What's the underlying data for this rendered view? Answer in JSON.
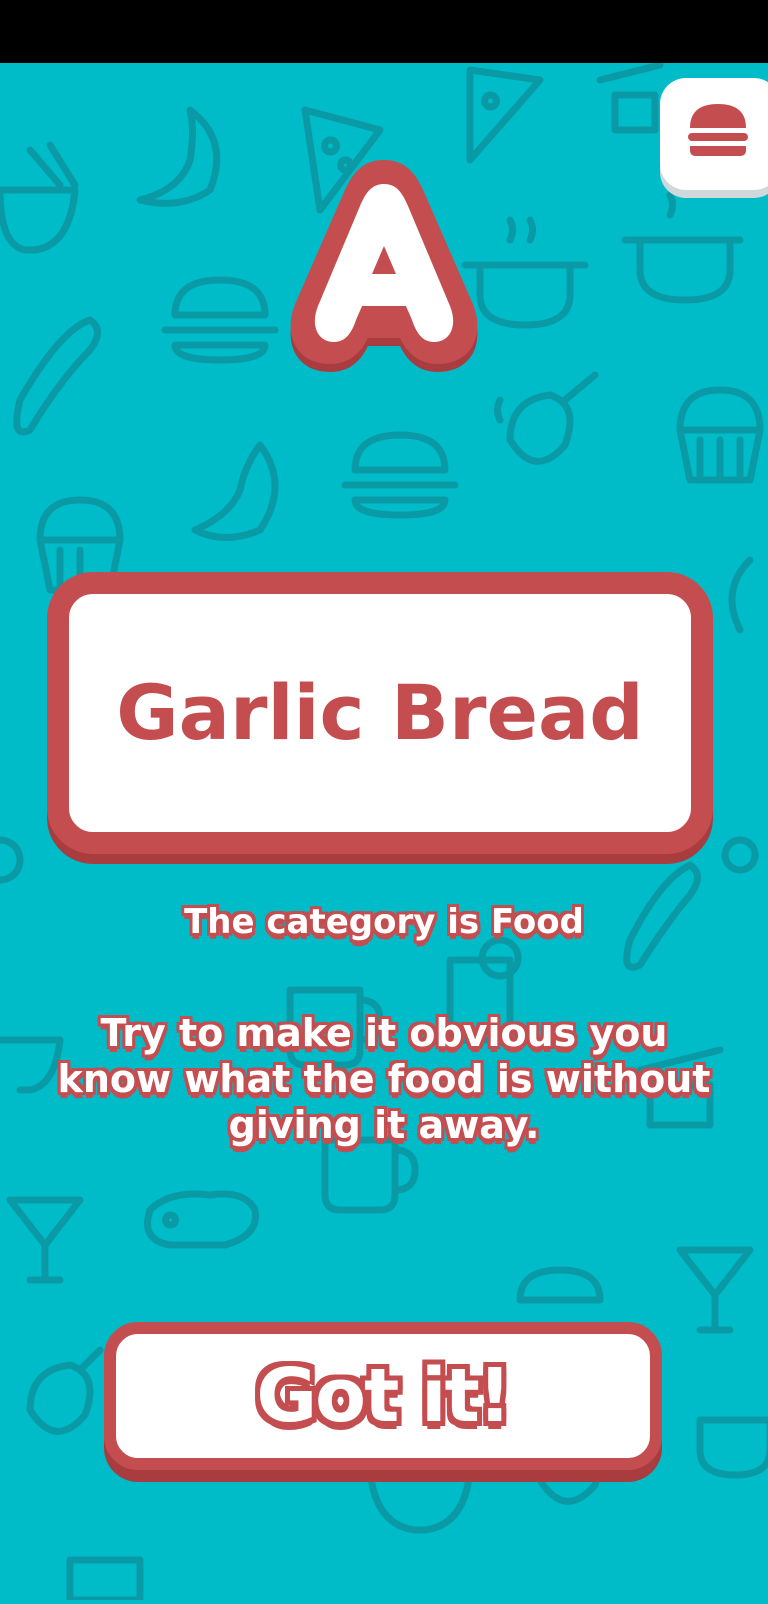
{
  "theme": {
    "background": "#00bcc9",
    "accent": "#c44d50",
    "pattern": "#0a9aa6",
    "card": "#ffffff"
  },
  "menu": {
    "icon": "hamburger-burger-icon"
  },
  "badge": {
    "letter": "A"
  },
  "card": {
    "word": "Garlic Bread"
  },
  "category_text": "The category is Food",
  "hint_text": "Try to make it obvious you know what the food is without giving it away.",
  "button": {
    "label": "Got it!"
  },
  "pattern_icons": [
    "croissant-icon",
    "pizza-slice-icon",
    "ramen-bowl-icon",
    "sushi-icon",
    "burger-icon",
    "hotdog-icon",
    "cooking-pot-icon",
    "cupcake-icon",
    "chicken-leg-icon",
    "mug-icon",
    "cocktail-icon",
    "steak-icon",
    "lemon-icon"
  ]
}
